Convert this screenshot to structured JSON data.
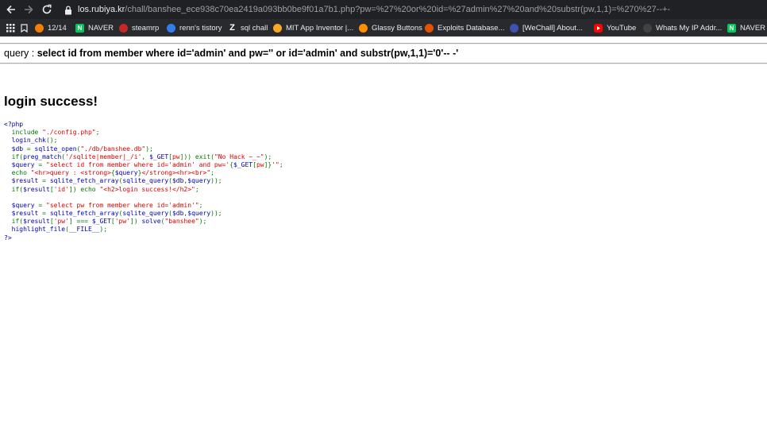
{
  "browser": {
    "url_host": "los.rubiya.kr",
    "url_path": "/chall/banshee_ece938c70ea2419a093bb0be9f01a7b1.php?pw=%27%20or%20id=%27admin%27%20and%20substr(pw,1,1)=%270%27--+-",
    "bookmarks": [
      {
        "label": "",
        "icon": "apps-grid-icon",
        "color": "#e8eaed"
      },
      {
        "label": "",
        "icon": "bookmark-folder-icon",
        "color": "#e8eaed"
      },
      {
        "label": "12/14",
        "icon": "blogger-icon",
        "color": "#f57d00"
      },
      {
        "label": "NAVER",
        "icon": "naver-icon",
        "color": "#03c75a"
      },
      {
        "label": "steamrp",
        "icon": "steamrp-icon",
        "color": "#c62828"
      },
      {
        "label": "renn's tistory",
        "icon": "tistory-icon",
        "color": "#2f80ed"
      },
      {
        "label": "sql chall",
        "icon": "z-icon",
        "color": "#ffffff"
      },
      {
        "label": "MIT App Inventor |...",
        "icon": "app-inventor-icon",
        "color": "#f9a825"
      },
      {
        "label": "Glassy Buttons",
        "icon": "glassy-icon",
        "color": "#ff8f00"
      },
      {
        "label": "Exploits Database...",
        "icon": "exploit-db-icon",
        "color": "#e65100"
      },
      {
        "label": "[WeChall] About...",
        "icon": "wechall-icon",
        "color": "#3f51b5"
      },
      {
        "label": "YouTube",
        "icon": "youtube-icon",
        "color": "#ff0000"
      },
      {
        "label": "Whats My IP Addr...",
        "icon": "ip-icon",
        "color": "#424242"
      },
      {
        "label": "NAVER",
        "icon": "naver-icon",
        "color": "#03c75a"
      }
    ]
  },
  "page": {
    "query_prefix": "query : ",
    "query": "select id from member where id='admin' and pw='' or id='admin' and substr(pw,1,1)='0'-- -'",
    "success": "login success!",
    "source_lines": [
      [
        {
          "t": "<?php",
          "c": "default"
        }
      ],
      [
        {
          "t": "  include ",
          "c": "keyword"
        },
        {
          "t": "\"./config.php\"",
          "c": "string"
        },
        {
          "t": ";",
          "c": "keyword"
        }
      ],
      [
        {
          "t": "  login_chk",
          "c": "default"
        },
        {
          "t": "();",
          "c": "keyword"
        }
      ],
      [
        {
          "t": "  $db ",
          "c": "default"
        },
        {
          "t": "= ",
          "c": "keyword"
        },
        {
          "t": "sqlite_open",
          "c": "default"
        },
        {
          "t": "(",
          "c": "keyword"
        },
        {
          "t": "\"./db/banshee.db\"",
          "c": "string"
        },
        {
          "t": ");",
          "c": "keyword"
        }
      ],
      [
        {
          "t": "  if(",
          "c": "keyword"
        },
        {
          "t": "preg_match",
          "c": "default"
        },
        {
          "t": "(",
          "c": "keyword"
        },
        {
          "t": "'/sqlite|member|_/i'",
          "c": "string"
        },
        {
          "t": ", ",
          "c": "keyword"
        },
        {
          "t": "$_GET",
          "c": "default"
        },
        {
          "t": "[",
          "c": "keyword"
        },
        {
          "t": "pw",
          "c": "string"
        },
        {
          "t": "])) exit(",
          "c": "keyword"
        },
        {
          "t": "\"No Hack ~_~\"",
          "c": "string"
        },
        {
          "t": ");",
          "c": "keyword"
        }
      ],
      [
        {
          "t": "  $query ",
          "c": "default"
        },
        {
          "t": "= ",
          "c": "keyword"
        },
        {
          "t": "\"select id from member where id='admin' and pw='",
          "c": "string"
        },
        {
          "t": "{",
          "c": "keyword"
        },
        {
          "t": "$_GET",
          "c": "default"
        },
        {
          "t": "[",
          "c": "keyword"
        },
        {
          "t": "pw",
          "c": "string"
        },
        {
          "t": "]",
          "c": "keyword"
        },
        {
          "t": "}",
          "c": "keyword"
        },
        {
          "t": "'\"",
          "c": "string"
        },
        {
          "t": ";",
          "c": "keyword"
        }
      ],
      [
        {
          "t": "  echo ",
          "c": "keyword"
        },
        {
          "t": "\"<hr>query : <strong>",
          "c": "string"
        },
        {
          "t": "{",
          "c": "keyword"
        },
        {
          "t": "$query",
          "c": "default"
        },
        {
          "t": "}",
          "c": "keyword"
        },
        {
          "t": "</strong><hr><br>\"",
          "c": "string"
        },
        {
          "t": ";",
          "c": "keyword"
        }
      ],
      [
        {
          "t": "  $result ",
          "c": "default"
        },
        {
          "t": "= ",
          "c": "keyword"
        },
        {
          "t": "sqlite_fetch_array",
          "c": "default"
        },
        {
          "t": "(",
          "c": "keyword"
        },
        {
          "t": "sqlite_query",
          "c": "default"
        },
        {
          "t": "(",
          "c": "keyword"
        },
        {
          "t": "$db",
          "c": "default"
        },
        {
          "t": ",",
          "c": "keyword"
        },
        {
          "t": "$query",
          "c": "default"
        },
        {
          "t": "));",
          "c": "keyword"
        }
      ],
      [
        {
          "t": "  if(",
          "c": "keyword"
        },
        {
          "t": "$result",
          "c": "default"
        },
        {
          "t": "[",
          "c": "keyword"
        },
        {
          "t": "'id'",
          "c": "string"
        },
        {
          "t": "]) echo ",
          "c": "keyword"
        },
        {
          "t": "\"<h2>login success!</h2>\"",
          "c": "string"
        },
        {
          "t": ";",
          "c": "keyword"
        }
      ],
      [
        {
          "t": "",
          "c": "keyword"
        }
      ],
      [
        {
          "t": "  $query ",
          "c": "default"
        },
        {
          "t": "= ",
          "c": "keyword"
        },
        {
          "t": "\"select pw from member where id='admin'\"",
          "c": "string"
        },
        {
          "t": ";",
          "c": "keyword"
        }
      ],
      [
        {
          "t": "  $result ",
          "c": "default"
        },
        {
          "t": "= ",
          "c": "keyword"
        },
        {
          "t": "sqlite_fetch_array",
          "c": "default"
        },
        {
          "t": "(",
          "c": "keyword"
        },
        {
          "t": "sqlite_query",
          "c": "default"
        },
        {
          "t": "(",
          "c": "keyword"
        },
        {
          "t": "$db",
          "c": "default"
        },
        {
          "t": ",",
          "c": "keyword"
        },
        {
          "t": "$query",
          "c": "default"
        },
        {
          "t": "));",
          "c": "keyword"
        }
      ],
      [
        {
          "t": "  if(",
          "c": "keyword"
        },
        {
          "t": "$result",
          "c": "default"
        },
        {
          "t": "[",
          "c": "keyword"
        },
        {
          "t": "'pw'",
          "c": "string"
        },
        {
          "t": "] === ",
          "c": "keyword"
        },
        {
          "t": "$_GET",
          "c": "default"
        },
        {
          "t": "[",
          "c": "keyword"
        },
        {
          "t": "'pw'",
          "c": "string"
        },
        {
          "t": "]) ",
          "c": "keyword"
        },
        {
          "t": "solve",
          "c": "default"
        },
        {
          "t": "(",
          "c": "keyword"
        },
        {
          "t": "\"banshee\"",
          "c": "string"
        },
        {
          "t": ");",
          "c": "keyword"
        }
      ],
      [
        {
          "t": "  highlight_file",
          "c": "default"
        },
        {
          "t": "(",
          "c": "keyword"
        },
        {
          "t": "__FILE__",
          "c": "default"
        },
        {
          "t": ");",
          "c": "keyword"
        }
      ],
      [
        {
          "t": "?>",
          "c": "default"
        }
      ]
    ]
  }
}
